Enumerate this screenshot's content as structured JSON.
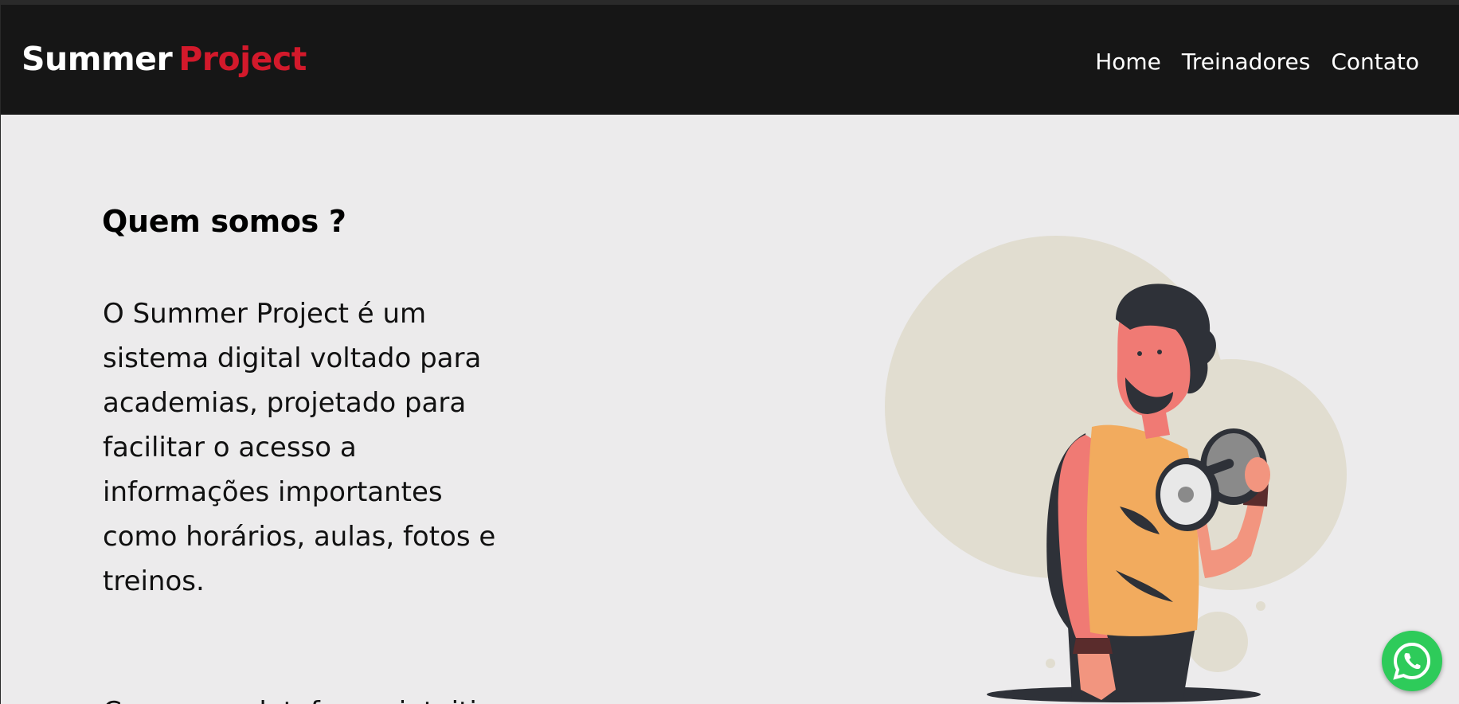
{
  "header": {
    "brand_part1": "Summer",
    "brand_part2": "Project",
    "nav": [
      "Home",
      "Treinadores",
      "Contato"
    ]
  },
  "main": {
    "heading": "Quem somos ?",
    "paragraph": "O Summer Project é um sistema digital voltado para academias, projetado para facilitar o acesso a informações importantes como horários, aulas, fotos e treinos.",
    "paragraph2": "Com uma plataforma intuitiva"
  },
  "illustration": {
    "icon": "man-lifting-dumbbell-illustration"
  },
  "floating": {
    "icon": "whatsapp-icon"
  },
  "colors": {
    "navbar": "#161616",
    "brand_accent": "#d3192b",
    "page_bg": "#ecebec",
    "blob": "#e1ddd0",
    "whatsapp": "#2ecb5a"
  }
}
